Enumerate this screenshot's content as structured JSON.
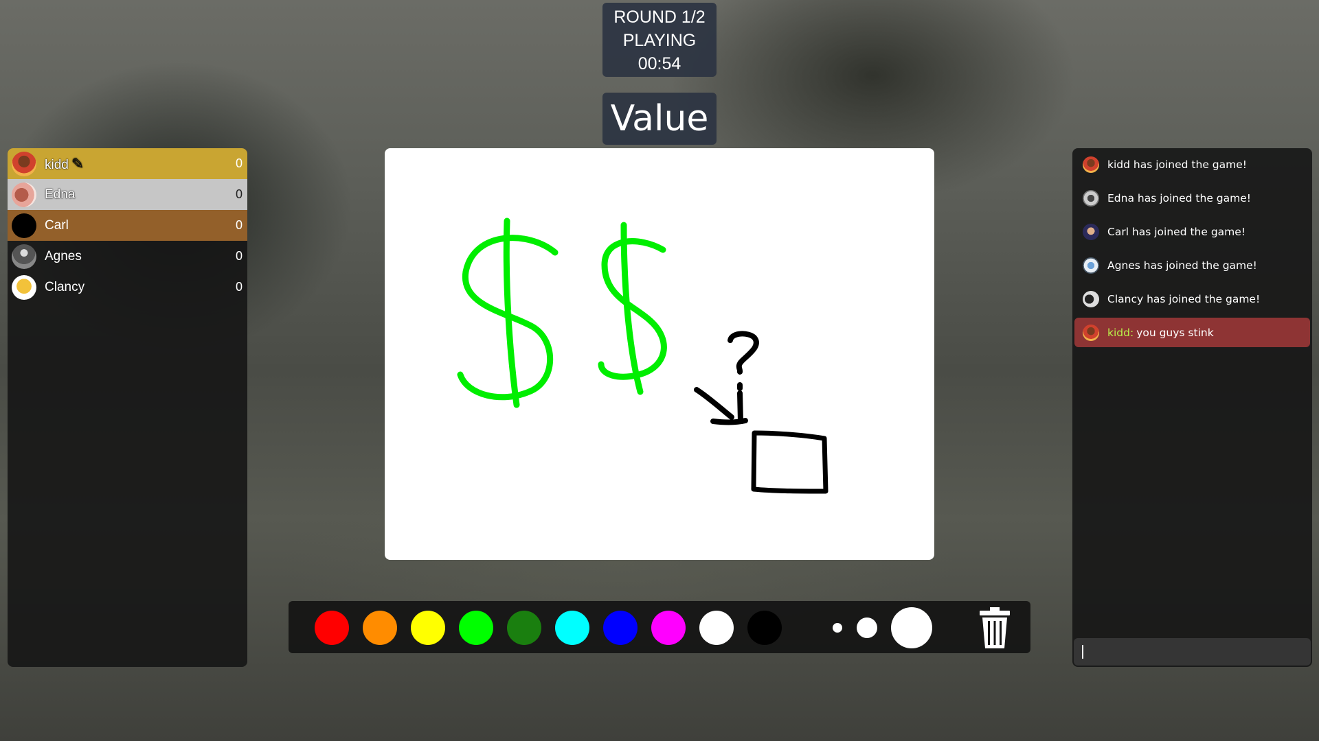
{
  "hud": {
    "round": "ROUND 1/2",
    "status": "PLAYING",
    "timer": "00:54"
  },
  "word": "Value",
  "players": [
    {
      "name": "kidd",
      "score": "0",
      "drawing": true,
      "rank": "gold"
    },
    {
      "name": "Edna",
      "score": "0",
      "drawing": false,
      "rank": "silver"
    },
    {
      "name": "Carl",
      "score": "0",
      "drawing": false,
      "rank": "bronze"
    },
    {
      "name": "Agnes",
      "score": "0",
      "drawing": false,
      "rank": "none"
    },
    {
      "name": "Clancy",
      "score": "0",
      "drawing": false,
      "rank": "none"
    }
  ],
  "palette": [
    "#ff0000",
    "#ff8c00",
    "#ffff00",
    "#00ff00",
    "#1a7f0f",
    "#00ffff",
    "#0000ff",
    "#ff00ff",
    "#ffffff",
    "#000000"
  ],
  "brush_sizes": [
    "small",
    "medium",
    "large"
  ],
  "chat": {
    "messages": [
      {
        "text": "kidd has joined the game!",
        "author": "",
        "system": true
      },
      {
        "text": "Edna has joined the game!",
        "author": "",
        "system": true
      },
      {
        "text": "Carl has joined the game!",
        "author": "",
        "system": true
      },
      {
        "text": "Agnes has joined the game!",
        "author": "",
        "system": true
      },
      {
        "text": "Clancy has joined the game!",
        "author": "",
        "system": true
      },
      {
        "text": "you guys stink",
        "author": "kidd:",
        "system": false
      }
    ],
    "input_value": ""
  },
  "icons": {
    "drawing_indicator": "pencil-icon",
    "clear_canvas": "trash-icon"
  },
  "colors": {
    "rank_gold": "#c9a532",
    "rank_silver": "#c6c6c6",
    "rank_bronze": "#93602a",
    "chat_highlight": "#8e3434",
    "chat_author": "#b8f04a"
  }
}
